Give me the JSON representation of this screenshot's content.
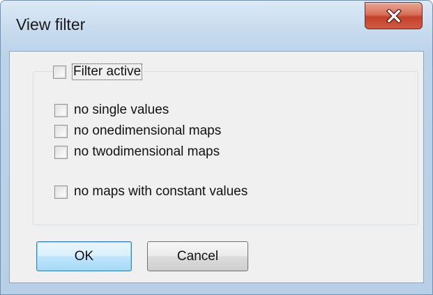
{
  "window": {
    "title": "View filter"
  },
  "filter_active": {
    "label": "Filter active",
    "checked": false
  },
  "options": [
    {
      "label": "no single values",
      "checked": false
    },
    {
      "label": "no onedimensional maps",
      "checked": false
    },
    {
      "label": "no twodimensional maps",
      "checked": false
    },
    {
      "label": "no maps with constant values",
      "checked": false
    }
  ],
  "buttons": {
    "ok": "OK",
    "cancel": "Cancel"
  },
  "icons": {
    "close": "close-icon"
  },
  "colors": {
    "close_button": "#c4412b",
    "default_button_border": "#3c7fb1"
  }
}
